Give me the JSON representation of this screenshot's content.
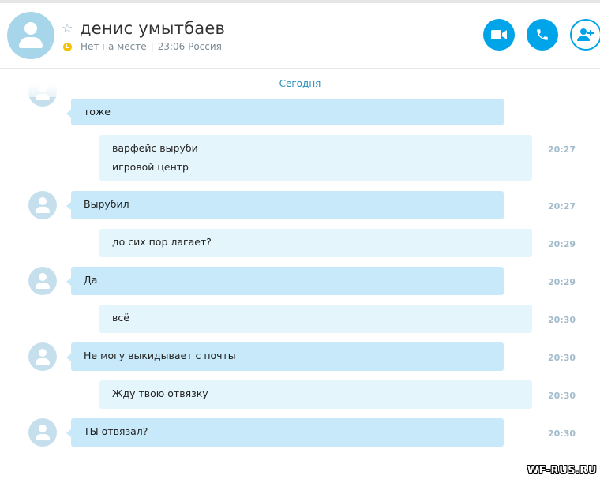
{
  "header": {
    "contact_name": "денис умытбаев",
    "status": "Нет на месте",
    "local_time": "23:06 Россия",
    "separator": "|"
  },
  "chat": {
    "date_separator": "Сегодня",
    "messages": [
      {
        "side": "in",
        "lines": [
          "тоже"
        ],
        "time": ""
      },
      {
        "side": "out",
        "lines": [
          "варфейс выруби",
          "игровой центр"
        ],
        "time": "20:27"
      },
      {
        "side": "in",
        "lines": [
          "Вырубил"
        ],
        "time": "20:27"
      },
      {
        "side": "out",
        "lines": [
          "до сих пор лагает?"
        ],
        "time": "20:29"
      },
      {
        "side": "in",
        "lines": [
          "Да"
        ],
        "time": "20:29"
      },
      {
        "side": "out",
        "lines": [
          "всё"
        ],
        "time": "20:30"
      },
      {
        "side": "in",
        "lines": [
          "Не могу выкидывает с почты"
        ],
        "time": "20:30"
      },
      {
        "side": "out",
        "lines": [
          "Жду твою отвязку"
        ],
        "time": "20:30"
      },
      {
        "side": "in",
        "lines": [
          "ТЫ отвязал?"
        ],
        "time": "20:30"
      }
    ]
  },
  "watermark": "WF-RUS.RU",
  "icons": {
    "favorite": "star-icon",
    "status": "clock-icon",
    "video": "video-camera-icon",
    "call": "phone-icon",
    "add": "add-person-icon",
    "avatar": "user-silhouette-icon"
  },
  "colors": {
    "accent": "#00a4e8",
    "incoming_bubble": "#c7e9f9",
    "outgoing_bubble": "#e5f5fc",
    "status_away": "#f8c100",
    "time_text": "#a3bccb"
  }
}
